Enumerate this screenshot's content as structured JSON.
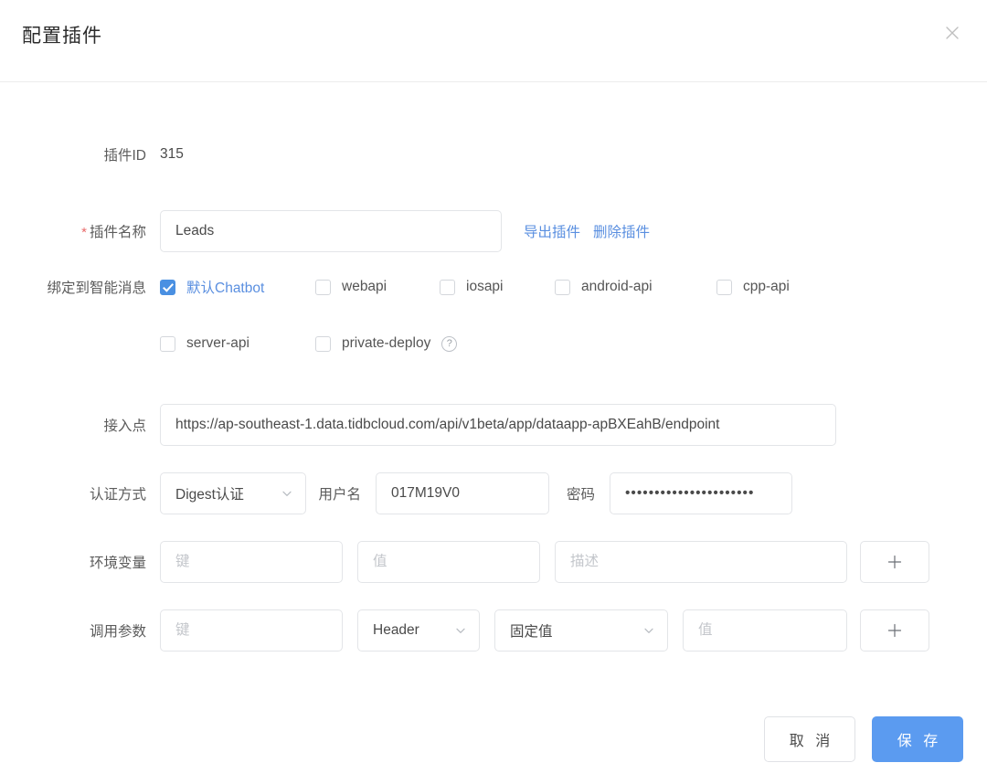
{
  "dialog": {
    "title": "配置插件",
    "close_icon": "close-icon"
  },
  "form": {
    "plugin_id": {
      "label": "插件ID",
      "value": "315"
    },
    "plugin_name": {
      "label": "插件名称",
      "required_mark": "*",
      "value": "Leads",
      "export_link": "导出插件",
      "delete_link": "删除插件"
    },
    "bind_messages": {
      "label": "绑定到智能消息",
      "options": [
        {
          "label": "默认Chatbot",
          "checked": true,
          "accent": true
        },
        {
          "label": "webapi",
          "checked": false,
          "accent": false
        },
        {
          "label": "iosapi",
          "checked": false,
          "accent": false
        },
        {
          "label": "android-api",
          "checked": false,
          "accent": false
        },
        {
          "label": "cpp-api",
          "checked": false,
          "accent": false
        },
        {
          "label": "server-api",
          "checked": false,
          "accent": false
        },
        {
          "label": "private-deploy",
          "checked": false,
          "accent": false
        }
      ],
      "help_icon": "?"
    },
    "endpoint": {
      "label": "接入点",
      "value": "https://ap-southeast-1.data.tidbcloud.com/api/v1beta/app/dataapp-apBXEahB/endpoint"
    },
    "auth": {
      "method_label": "认证方式",
      "method_value": "Digest认证",
      "username_label": "用户名",
      "username_value": "017M19V0",
      "password_label": "密码",
      "password_value": "••••••••••••••••••••••"
    },
    "env_vars": {
      "label": "环境变量",
      "key_placeholder": "键",
      "value_placeholder": "值",
      "desc_placeholder": "描述",
      "add_label": "+"
    },
    "call_params": {
      "label": "调用参数",
      "key_placeholder": "键",
      "type_value": "Header",
      "mode_value": "固定值",
      "value_placeholder": "值",
      "add_label": "+"
    }
  },
  "footer": {
    "cancel_label": "取 消",
    "save_label": "保 存"
  },
  "colors": {
    "accent": "#5a8fe0",
    "primary_button": "#5b9bf0",
    "required": "#e96a6a"
  }
}
